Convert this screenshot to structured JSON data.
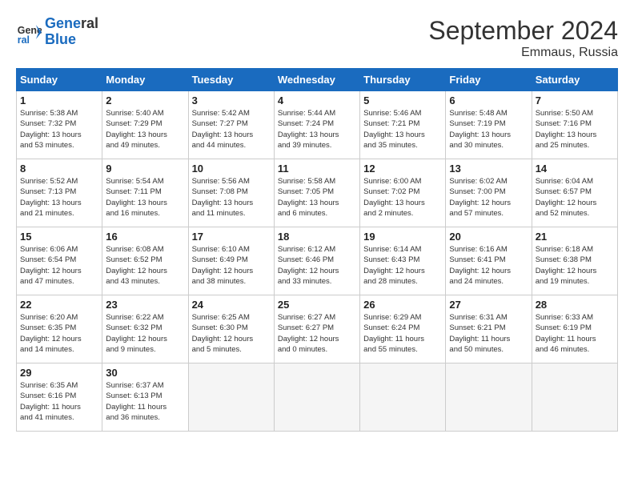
{
  "logo": {
    "line1": "General",
    "line2": "Blue"
  },
  "title": "September 2024",
  "location": "Emmaus, Russia",
  "weekdays": [
    "Sunday",
    "Monday",
    "Tuesday",
    "Wednesday",
    "Thursday",
    "Friday",
    "Saturday"
  ],
  "weeks": [
    [
      {
        "day": "1",
        "lines": [
          "Sunrise: 5:38 AM",
          "Sunset: 7:32 PM",
          "Daylight: 13 hours",
          "and 53 minutes."
        ]
      },
      {
        "day": "2",
        "lines": [
          "Sunrise: 5:40 AM",
          "Sunset: 7:29 PM",
          "Daylight: 13 hours",
          "and 49 minutes."
        ]
      },
      {
        "day": "3",
        "lines": [
          "Sunrise: 5:42 AM",
          "Sunset: 7:27 PM",
          "Daylight: 13 hours",
          "and 44 minutes."
        ]
      },
      {
        "day": "4",
        "lines": [
          "Sunrise: 5:44 AM",
          "Sunset: 7:24 PM",
          "Daylight: 13 hours",
          "and 39 minutes."
        ]
      },
      {
        "day": "5",
        "lines": [
          "Sunrise: 5:46 AM",
          "Sunset: 7:21 PM",
          "Daylight: 13 hours",
          "and 35 minutes."
        ]
      },
      {
        "day": "6",
        "lines": [
          "Sunrise: 5:48 AM",
          "Sunset: 7:19 PM",
          "Daylight: 13 hours",
          "and 30 minutes."
        ]
      },
      {
        "day": "7",
        "lines": [
          "Sunrise: 5:50 AM",
          "Sunset: 7:16 PM",
          "Daylight: 13 hours",
          "and 25 minutes."
        ]
      }
    ],
    [
      {
        "day": "8",
        "lines": [
          "Sunrise: 5:52 AM",
          "Sunset: 7:13 PM",
          "Daylight: 13 hours",
          "and 21 minutes."
        ]
      },
      {
        "day": "9",
        "lines": [
          "Sunrise: 5:54 AM",
          "Sunset: 7:11 PM",
          "Daylight: 13 hours",
          "and 16 minutes."
        ]
      },
      {
        "day": "10",
        "lines": [
          "Sunrise: 5:56 AM",
          "Sunset: 7:08 PM",
          "Daylight: 13 hours",
          "and 11 minutes."
        ]
      },
      {
        "day": "11",
        "lines": [
          "Sunrise: 5:58 AM",
          "Sunset: 7:05 PM",
          "Daylight: 13 hours",
          "and 6 minutes."
        ]
      },
      {
        "day": "12",
        "lines": [
          "Sunrise: 6:00 AM",
          "Sunset: 7:02 PM",
          "Daylight: 13 hours",
          "and 2 minutes."
        ]
      },
      {
        "day": "13",
        "lines": [
          "Sunrise: 6:02 AM",
          "Sunset: 7:00 PM",
          "Daylight: 12 hours",
          "and 57 minutes."
        ]
      },
      {
        "day": "14",
        "lines": [
          "Sunrise: 6:04 AM",
          "Sunset: 6:57 PM",
          "Daylight: 12 hours",
          "and 52 minutes."
        ]
      }
    ],
    [
      {
        "day": "15",
        "lines": [
          "Sunrise: 6:06 AM",
          "Sunset: 6:54 PM",
          "Daylight: 12 hours",
          "and 47 minutes."
        ]
      },
      {
        "day": "16",
        "lines": [
          "Sunrise: 6:08 AM",
          "Sunset: 6:52 PM",
          "Daylight: 12 hours",
          "and 43 minutes."
        ]
      },
      {
        "day": "17",
        "lines": [
          "Sunrise: 6:10 AM",
          "Sunset: 6:49 PM",
          "Daylight: 12 hours",
          "and 38 minutes."
        ]
      },
      {
        "day": "18",
        "lines": [
          "Sunrise: 6:12 AM",
          "Sunset: 6:46 PM",
          "Daylight: 12 hours",
          "and 33 minutes."
        ]
      },
      {
        "day": "19",
        "lines": [
          "Sunrise: 6:14 AM",
          "Sunset: 6:43 PM",
          "Daylight: 12 hours",
          "and 28 minutes."
        ]
      },
      {
        "day": "20",
        "lines": [
          "Sunrise: 6:16 AM",
          "Sunset: 6:41 PM",
          "Daylight: 12 hours",
          "and 24 minutes."
        ]
      },
      {
        "day": "21",
        "lines": [
          "Sunrise: 6:18 AM",
          "Sunset: 6:38 PM",
          "Daylight: 12 hours",
          "and 19 minutes."
        ]
      }
    ],
    [
      {
        "day": "22",
        "lines": [
          "Sunrise: 6:20 AM",
          "Sunset: 6:35 PM",
          "Daylight: 12 hours",
          "and 14 minutes."
        ]
      },
      {
        "day": "23",
        "lines": [
          "Sunrise: 6:22 AM",
          "Sunset: 6:32 PM",
          "Daylight: 12 hours",
          "and 9 minutes."
        ]
      },
      {
        "day": "24",
        "lines": [
          "Sunrise: 6:25 AM",
          "Sunset: 6:30 PM",
          "Daylight: 12 hours",
          "and 5 minutes."
        ]
      },
      {
        "day": "25",
        "lines": [
          "Sunrise: 6:27 AM",
          "Sunset: 6:27 PM",
          "Daylight: 12 hours",
          "and 0 minutes."
        ]
      },
      {
        "day": "26",
        "lines": [
          "Sunrise: 6:29 AM",
          "Sunset: 6:24 PM",
          "Daylight: 11 hours",
          "and 55 minutes."
        ]
      },
      {
        "day": "27",
        "lines": [
          "Sunrise: 6:31 AM",
          "Sunset: 6:21 PM",
          "Daylight: 11 hours",
          "and 50 minutes."
        ]
      },
      {
        "day": "28",
        "lines": [
          "Sunrise: 6:33 AM",
          "Sunset: 6:19 PM",
          "Daylight: 11 hours",
          "and 46 minutes."
        ]
      }
    ],
    [
      {
        "day": "29",
        "lines": [
          "Sunrise: 6:35 AM",
          "Sunset: 6:16 PM",
          "Daylight: 11 hours",
          "and 41 minutes."
        ]
      },
      {
        "day": "30",
        "lines": [
          "Sunrise: 6:37 AM",
          "Sunset: 6:13 PM",
          "Daylight: 11 hours",
          "and 36 minutes."
        ]
      },
      {
        "day": "",
        "lines": []
      },
      {
        "day": "",
        "lines": []
      },
      {
        "day": "",
        "lines": []
      },
      {
        "day": "",
        "lines": []
      },
      {
        "day": "",
        "lines": []
      }
    ]
  ]
}
